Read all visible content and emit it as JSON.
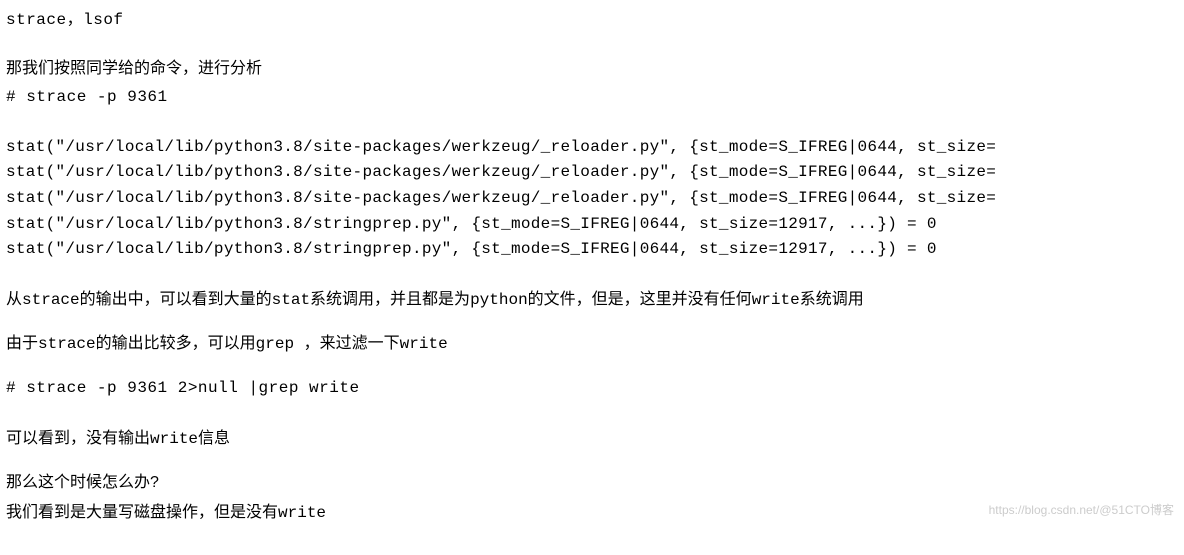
{
  "line1": "strace，lsof",
  "line2": "那我们按照同学给的命令，进行分析",
  "cmd1": "# strace -p 9361",
  "stat_lines": {
    "l1": "stat(\"/usr/local/lib/python3.8/site-packages/werkzeug/_reloader.py\", {st_mode=S_IFREG|0644, st_size=",
    "l2": "stat(\"/usr/local/lib/python3.8/site-packages/werkzeug/_reloader.py\", {st_mode=S_IFREG|0644, st_size=",
    "l3": "stat(\"/usr/local/lib/python3.8/site-packages/werkzeug/_reloader.py\", {st_mode=S_IFREG|0644, st_size=",
    "l4": "stat(\"/usr/local/lib/python3.8/stringprep.py\", {st_mode=S_IFREG|0644, st_size=12917, ...}) = 0",
    "l5": "stat(\"/usr/local/lib/python3.8/stringprep.py\", {st_mode=S_IFREG|0644, st_size=12917, ...}) = 0"
  },
  "para1_a": "从",
  "para1_kw1": "strace",
  "para1_b": "的输出中，可以看到大量的",
  "para1_kw2": "stat",
  "para1_c": "系统调用，并且都是为",
  "para1_kw3": "python",
  "para1_d": "的文件，但是，这里并没有任何",
  "para1_kw4": "write",
  "para1_e": "系统调用",
  "para2_a": "由于",
  "para2_kw1": "strace",
  "para2_b": "的输出比较多，可以用",
  "para2_kw2": "grep ",
  "para2_c": "，来过滤一下",
  "para2_kw3": "write",
  "cmd2": "# strace -p 9361 2>null |grep write",
  "para3_a": "可以看到，没有输出",
  "para3_kw1": "write",
  "para3_b": "信息",
  "para4": "那么这个时候怎么办?",
  "para5_a": "我们看到是大量写磁盘操作，但是没有",
  "para5_kw1": "write",
  "watermark": "https://blog.csdn.net/@51CTO博客"
}
